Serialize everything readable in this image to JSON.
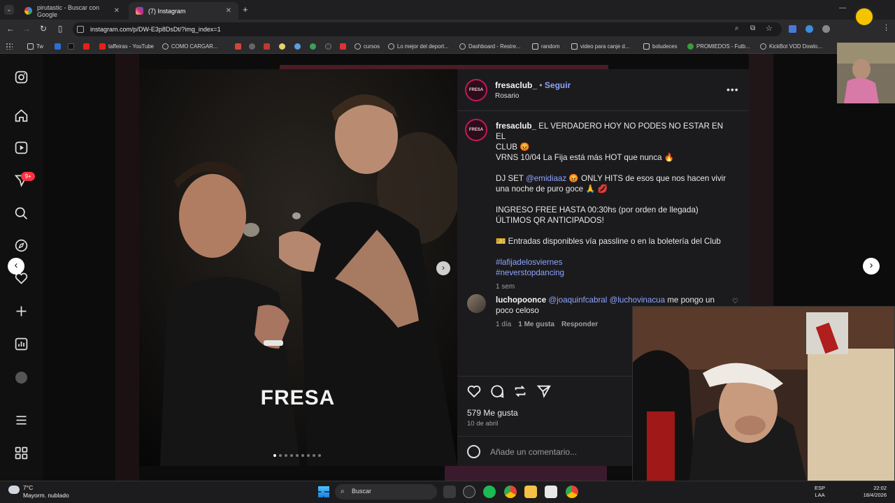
{
  "browser": {
    "tabs": [
      {
        "title": "pirutastic - Buscar con Google",
        "active": false
      },
      {
        "title": "(7) Instagram",
        "active": true
      }
    ],
    "url": "instagram.com/p/DW-E3p8DsDt/?img_index=1",
    "bookmarks": [
      "Tw",
      "taffeiras - YouTube",
      "COMO CARGAR...",
      "cursos",
      "Lo mejor del deport...",
      "Dashboard - Restre...",
      "random",
      "video para canje d...",
      "boludeces",
      "PROMIEDOS - Futb...",
      "KickBot VOD Dowlo..."
    ]
  },
  "instagram": {
    "notifications_badge": "9+",
    "post": {
      "username": "fresaclub_",
      "follow_label": "Seguir",
      "location": "Rosario",
      "photo_logo": "FRESA",
      "caption": {
        "line1": "EL VERDADERO HOY NO PODES NO ESTAR EN EL",
        "line2": "CLUB 😡",
        "line3": "VRNS 10/04 La Fija está más HOT que nunca 🔥",
        "dj_prefix": "DJ SET",
        "dj_mention": "@emidiaaz",
        "dj_rest": "😡 ONLY HITS de esos que nos hacen vivir",
        "dj_line2": "una noche de puro goce 🙏 💋",
        "ingreso1": "INGRESO FREE HASTA 00:30hs (por orden de llegada)",
        "ingreso2": "ÚLTIMOS QR ANTICIPADOS!",
        "entradas": "🎫 Entradas disponibles vía passline o en la boletería del Club",
        "hashtag1": "#lafijadelosviernes",
        "hashtag2": "#neverstopdancing",
        "time": "1 sem"
      },
      "comment": {
        "username": "luchopoonce",
        "mention1": "@joaquinfcabral",
        "mention2": "@luchovinacua",
        "text1": "me pongo un",
        "text2": "poco celoso",
        "time": "1 día",
        "likes": "1 Me gusta",
        "reply": "Responder"
      },
      "likes": "579 Me gusta",
      "date": "10 de abril",
      "comment_placeholder": "Añade un comentario...",
      "carousel_dots": 9,
      "carousel_active_dot": 1
    }
  },
  "taskbar": {
    "weather_temp": "7°C",
    "weather_desc": "Mayorm. nublado",
    "search_label": "Buscar",
    "lang1": "ESP",
    "lang2": "LAA",
    "time": "22:02",
    "date": "18/4/2026"
  },
  "colors": {
    "link": "#8fa4ff",
    "brand_pink": "#c2185b"
  }
}
